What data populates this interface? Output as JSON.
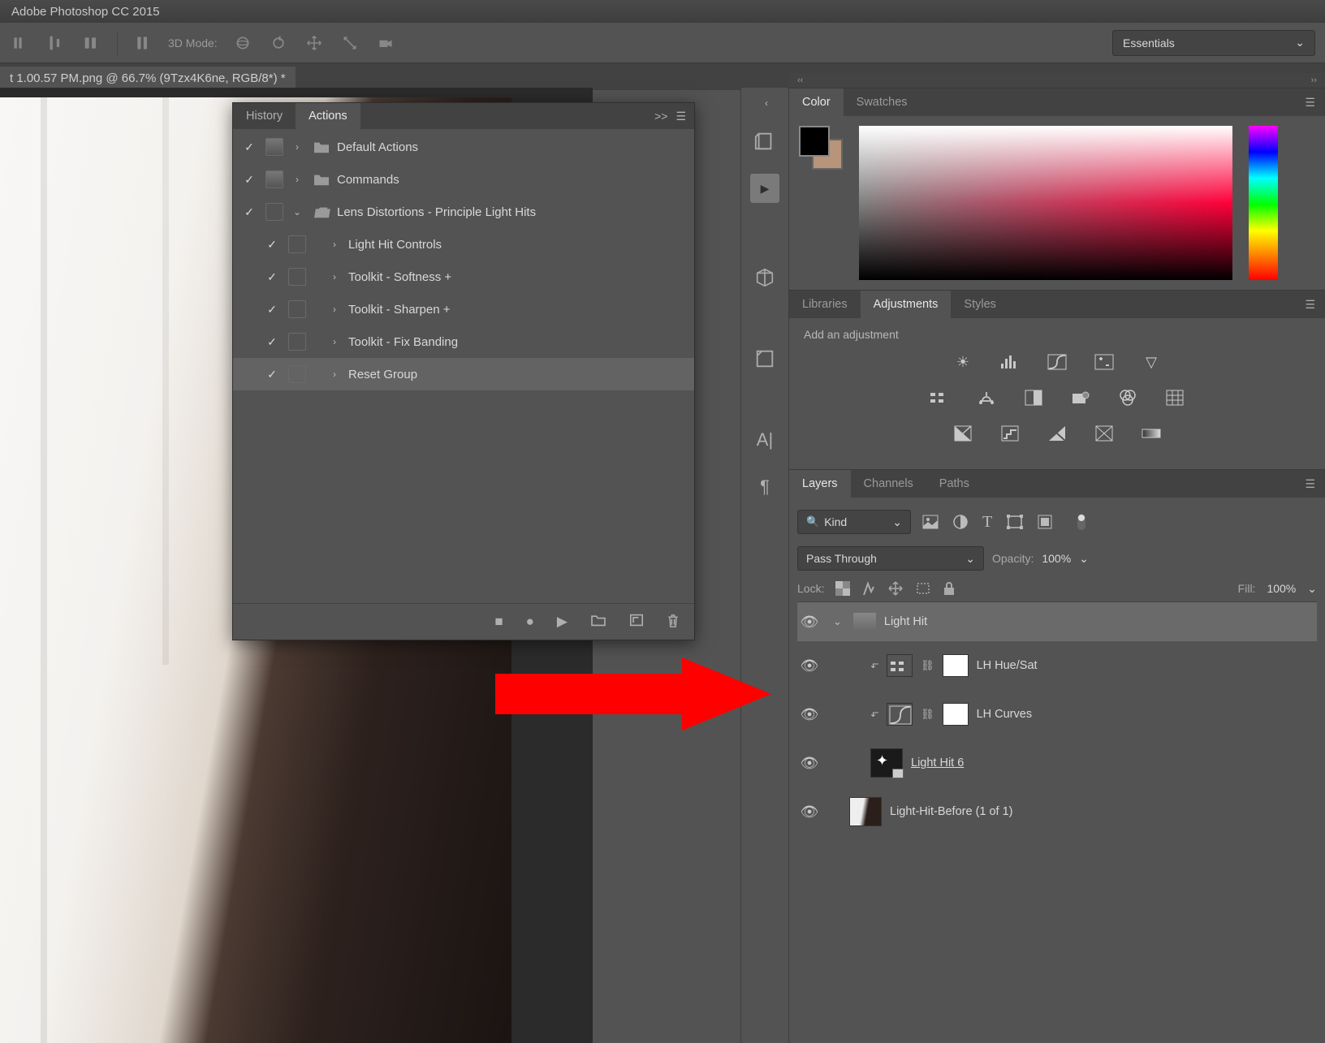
{
  "app": {
    "title": "Adobe Photoshop CC 2015"
  },
  "toolbar": {
    "mode_label": "3D Mode:",
    "workspace": "Essentials"
  },
  "document": {
    "tab": "t 1.00.57 PM.png @ 66.7% (9Tzx4K6ne, RGB/8*) *"
  },
  "actions_panel": {
    "tabs": {
      "history": "History",
      "actions": "Actions"
    },
    "items": [
      {
        "label": "Default Actions",
        "folder": true,
        "arrow": "›",
        "box": true
      },
      {
        "label": "Commands",
        "folder": true,
        "arrow": "›",
        "box": true
      },
      {
        "label": "Lens Distortions - Principle Light Hits",
        "folder": true,
        "arrow": "⌄",
        "box": false
      },
      {
        "label": "Light Hit Controls",
        "indent": true,
        "arrow": "›"
      },
      {
        "label": "Toolkit - Softness +",
        "indent": true,
        "arrow": "›"
      },
      {
        "label": "Toolkit - Sharpen +",
        "indent": true,
        "arrow": "›"
      },
      {
        "label": "Toolkit - Fix Banding",
        "indent": true,
        "arrow": "›"
      },
      {
        "label": "Reset Group",
        "indent": true,
        "arrow": "›",
        "selected": true
      }
    ]
  },
  "color_panel": {
    "tabs": {
      "color": "Color",
      "swatches": "Swatches"
    }
  },
  "adjust_panel": {
    "tabs": {
      "libraries": "Libraries",
      "adjustments": "Adjustments",
      "styles": "Styles"
    },
    "prompt": "Add an adjustment"
  },
  "layers_panel": {
    "tabs": {
      "layers": "Layers",
      "channels": "Channels",
      "paths": "Paths"
    },
    "filter_kind": "Kind",
    "blend_mode": "Pass Through",
    "opacity_label": "Opacity:",
    "opacity_value": "100%",
    "lock_label": "Lock:",
    "fill_label": "Fill:",
    "fill_value": "100%",
    "items": [
      {
        "type": "group",
        "name": "Light Hit",
        "selected": true
      },
      {
        "type": "adj",
        "name": "LH Hue/Sat",
        "clipped": true
      },
      {
        "type": "adj",
        "name": "LH Curves",
        "clipped": true
      },
      {
        "type": "smart",
        "name": "Light Hit 6",
        "underlined": true
      },
      {
        "type": "layer",
        "name": "Light-Hit-Before (1 of 1)"
      }
    ]
  }
}
